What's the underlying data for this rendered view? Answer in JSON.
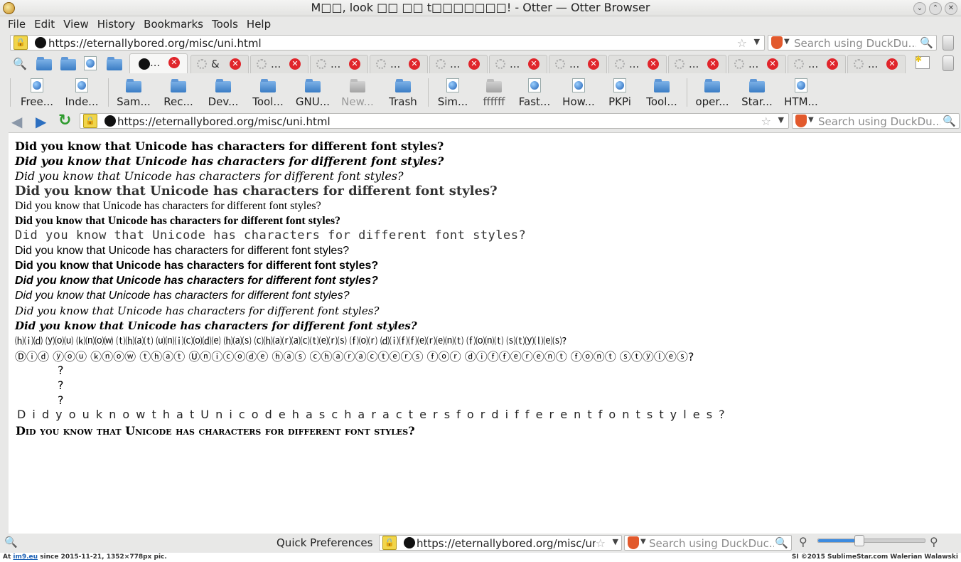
{
  "window": {
    "title": "M□□, look □□ □□ t□□□□□□□! - Otter — Otter Browser"
  },
  "menu": [
    "File",
    "Edit",
    "View",
    "History",
    "Bookmarks",
    "Tools",
    "Help"
  ],
  "top_address": {
    "url": "https://eternallybored.org/misc/uni.html",
    "search_placeholder": "Search using DuckDu..."
  },
  "tabs": [
    {
      "label": "...",
      "active": true
    },
    {
      "label": "&",
      "active": false
    },
    {
      "label": "...",
      "active": false
    },
    {
      "label": "...",
      "active": false
    },
    {
      "label": "...",
      "active": false
    },
    {
      "label": "...",
      "active": false
    },
    {
      "label": "...",
      "active": false
    },
    {
      "label": "...",
      "active": false
    },
    {
      "label": "...",
      "active": false
    },
    {
      "label": "...",
      "active": false
    },
    {
      "label": "...",
      "active": false
    },
    {
      "label": "...",
      "active": false
    },
    {
      "label": "...",
      "active": false
    }
  ],
  "bookmarks": [
    {
      "label": "Free..."
    },
    {
      "label": "Inde..."
    },
    {
      "label": "Sam..."
    },
    {
      "label": "Rec..."
    },
    {
      "label": "Dev..."
    },
    {
      "label": "Tool..."
    },
    {
      "label": "GNU..."
    },
    {
      "label": "New..."
    },
    {
      "label": "Trash"
    },
    {
      "label": "Sim..."
    },
    {
      "label": "ffffff"
    },
    {
      "label": "Fast..."
    },
    {
      "label": "How..."
    },
    {
      "label": "PKPi"
    },
    {
      "label": "Tool..."
    },
    {
      "label": "oper..."
    },
    {
      "label": "Star..."
    },
    {
      "label": "HTM..."
    }
  ],
  "nav_address": {
    "url": "https://eternallybored.org/misc/uni.html",
    "search_placeholder": "Search using DuckDu..."
  },
  "content": {
    "lines": [
      "Did you know that Unicode has characters for different font styles?",
      "Did you know that Unicode has characters for different font styles?",
      "Did you know that Unicode has characters for different font styles?",
      "Did you know that Unicode has characters for different font styles?",
      "Did you know that Unicode has characters for different font styles?",
      "Did you know that Unicode has characters for different font styles?",
      "Did you know that Unicode has characters for different font styles?",
      "Did you know that Unicode has characters for different font styles?",
      "Did you know that Unicode has characters for different font styles?",
      "Did you know that Unicode has characters for different font styles?",
      "Did you know that Unicode has characters for different font styles?",
      "Did you know that Unicode has characters for different font styles?",
      "Did you know that Unicode has characters for different font styles?",
      "⒣⒤⒟ ⒴⒪⒰ ⒦⒩⒪⒲ ⒯⒣⒜⒯ ⒰⒩⒤⒞⒪⒟⒠ ⒣⒜⒮ ⒞⒣⒜⒭⒜⒞⒯⒠⒭⒮ ⒡⒪⒭ ⒟⒤⒡⒡⒠⒭⒠⒩⒯ ⒡⒪⒩⒯ ⒮⒯⒴⒧⒠⒮?",
      "Ⓓⓘⓓ ⓨⓞⓤ ⓚⓝⓞⓦ ⓣⓗⓐⓣ Ⓤⓝⓘⓒⓞⓓⓔ ⓗⓐⓢ ⓒⓗⓐⓡⓐⓒⓣⓔⓡⓢ ⓕⓞⓡ ⓓⓘⓕⓕⓔⓡⓔⓝⓣ ⓕⓞⓝⓣ ⓢⓣⓨⓛⓔⓢ?",
      "?",
      "?",
      "?",
      "D i d  y o u  k n o w  t h a t  U n i c o d e  h a s  c h a r a c t e r s  f o r  d i f f e r e n t  f o n t  s t y l e s ?",
      "Did you know that Unicode has characters for different font styles?"
    ]
  },
  "status": {
    "quick_prefs": "Quick Preferences",
    "url": "https://eternallybored.org/misc/uni",
    "search_placeholder": "Search using DuckDuc...",
    "zoom_fraction": 0.38
  },
  "footer": {
    "left_prefix": "At ",
    "left_link": "im9.eu",
    "left_suffix": " since 2015-11-21, 1352×778px pic.",
    "right": "SI ©2015 SublimeStar.com Walerian Walawski"
  }
}
